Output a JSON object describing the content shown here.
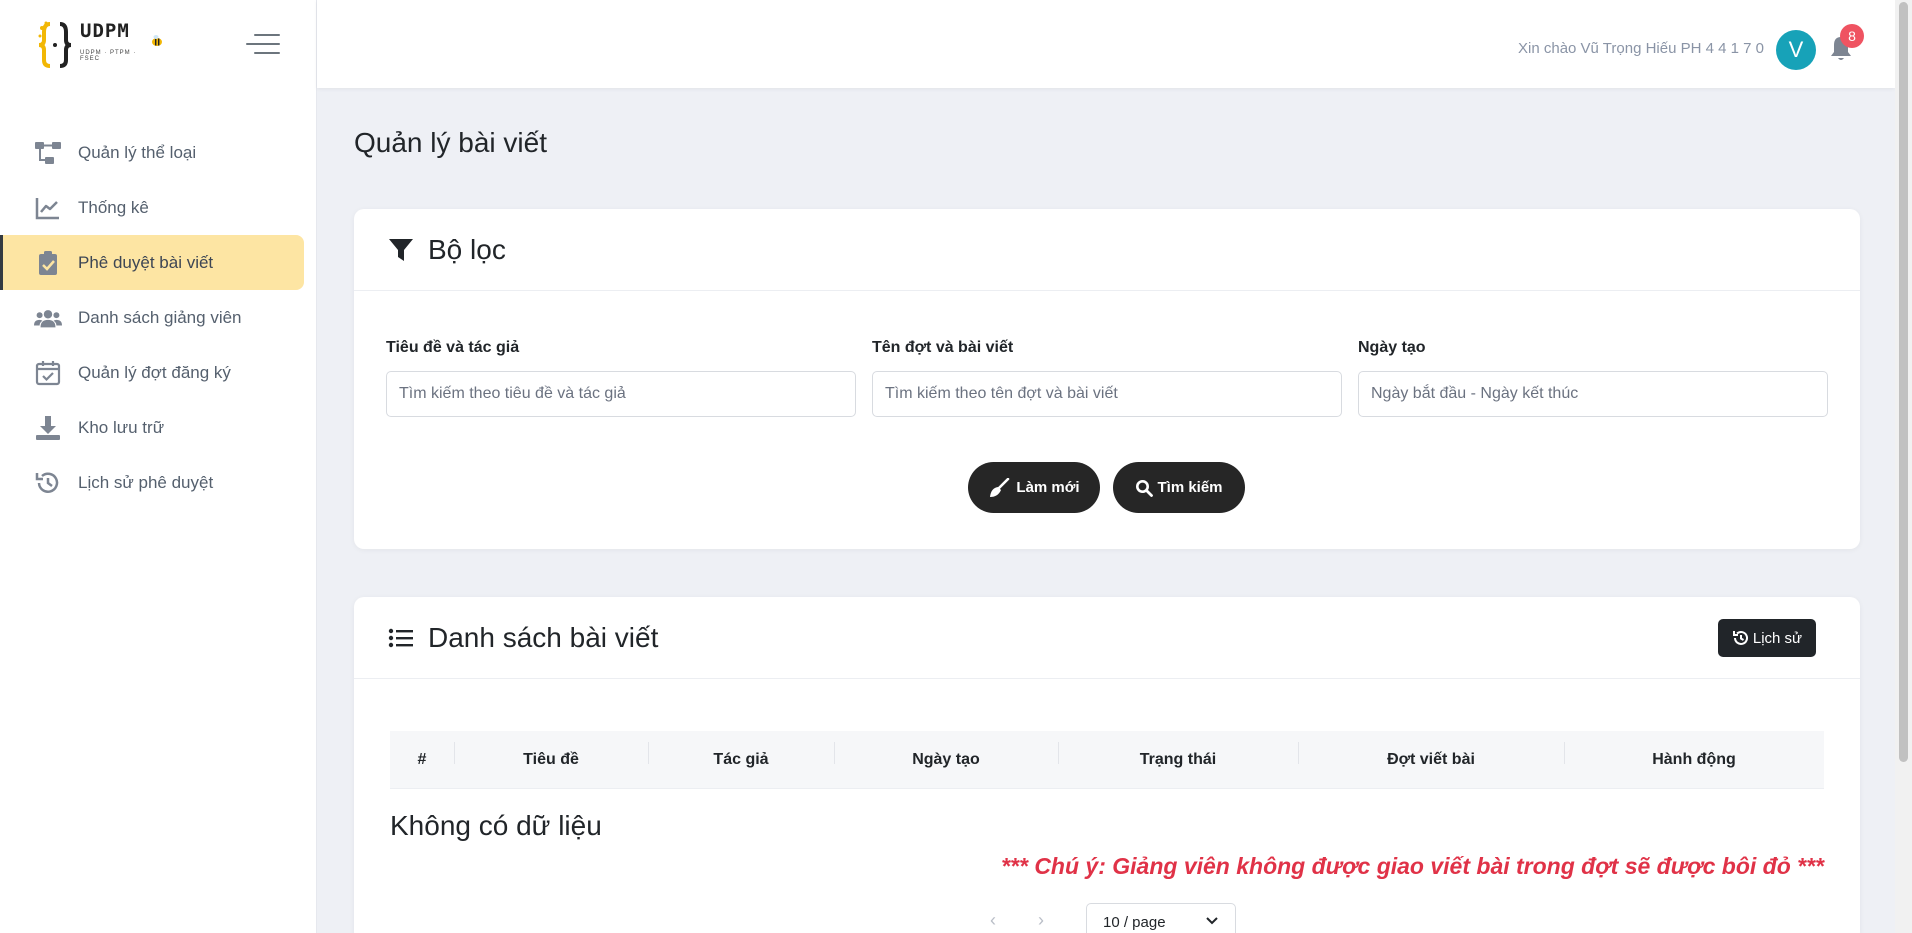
{
  "brand": {
    "name": "UDPM",
    "tagline": "UDPM · PTPM · FSEC"
  },
  "sidebar": {
    "items": [
      {
        "label": "Quản lý thể loại",
        "icon": "category-tree-icon"
      },
      {
        "label": "Thống kê",
        "icon": "chart-line-icon"
      },
      {
        "label": "Phê duyệt bài viết",
        "icon": "clipboard-check-icon"
      },
      {
        "label": "Danh sách giảng viên",
        "icon": "users-icon"
      },
      {
        "label": "Quản lý đợt đăng ký",
        "icon": "calendar-check-icon"
      },
      {
        "label": "Kho lưu trữ",
        "icon": "download-icon"
      },
      {
        "label": "Lịch sử phê duyệt",
        "icon": "history-icon"
      }
    ],
    "active_index": 2
  },
  "header": {
    "greeting": "Xin chào Vũ Trọng Hiếu PH 4 4 1 7 0",
    "avatar_letter": "V",
    "notification_count": "8"
  },
  "page": {
    "title": "Quản lý bài viết"
  },
  "filter": {
    "title": "Bộ lọc",
    "fields": [
      {
        "label": "Tiêu đề và tác giả",
        "placeholder": "Tìm kiếm theo tiêu đề và tác giả"
      },
      {
        "label": "Tên đợt và bài viết",
        "placeholder": "Tìm kiếm theo tên đợt và bài viết"
      },
      {
        "label": "Ngày tạo",
        "placeholder": "Ngày bắt đầu - Ngày kết thúc"
      }
    ],
    "reset_label": "Làm mới",
    "search_label": "Tìm kiếm"
  },
  "list": {
    "title": "Danh sách bài viết",
    "history_label": "Lịch sử",
    "columns": [
      "#",
      "Tiêu đề",
      "Tác giả",
      "Ngày tạo",
      "Trạng thái",
      "Đợt viết bài",
      "Hành động"
    ],
    "empty_text": "Không có dữ liệu",
    "note": "*** Chú ý: Giảng viên không được giao viết bài trong đợt sẽ được bôi đỏ ***",
    "page_size": "10 / page"
  },
  "colors": {
    "active_nav": "#fde5a3",
    "avatar": "#17a2b8",
    "badge": "#ef5361",
    "note": "#e03247",
    "dark_button": "#262626"
  }
}
